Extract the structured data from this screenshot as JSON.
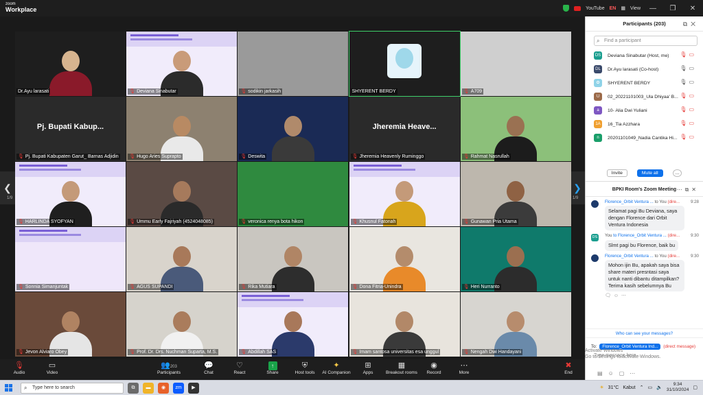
{
  "titlebar": {
    "brand_small": "zoom",
    "brand_big": "Workplace",
    "youtube": "YouTube",
    "lang": "EN",
    "view": "View"
  },
  "colors": {
    "accent": "#0e71eb",
    "muted": "#e53935",
    "toolbar_bg": "#1e1e1e",
    "stage_bg": "#1a1a1a"
  },
  "nav": {
    "page_left": "1/9",
    "page_right": "1/9"
  },
  "tiles": [
    {
      "name": "Dr.Ayu larasati",
      "muted": false
    },
    {
      "name": "Deviana Sinabutar",
      "muted": true
    },
    {
      "name": "sodikin jarkasih",
      "muted": true
    },
    {
      "name": "SHYERENT BERDY",
      "muted": false
    },
    {
      "name": "A709",
      "muted": true
    },
    {
      "name": "Pj. Bupati Kabupaten Garut_ Barnas Adjidin",
      "muted": true,
      "big": "Pj. Bupati Kabup..."
    },
    {
      "name": "Hugo Aries Suprapto",
      "muted": true
    },
    {
      "name": "Deswita",
      "muted": true
    },
    {
      "name": "Jheremia Heavenly Ruminggo",
      "muted": true,
      "big": "Jheremia Heave..."
    },
    {
      "name": "Rahmat Nasrullah",
      "muted": true
    },
    {
      "name": "HARLINDA SYOFYAN",
      "muted": true
    },
    {
      "name": "Ummu Early Fajriyah (4524048085)",
      "muted": true
    },
    {
      "name": "veronica renya bota hikon",
      "muted": true
    },
    {
      "name": "Khusnul Fatonah",
      "muted": true
    },
    {
      "name": "Gunawan Pria Utama",
      "muted": true
    },
    {
      "name": "Sonnia Simanjuntak",
      "muted": true
    },
    {
      "name": "AGUS SUPANDI",
      "muted": true
    },
    {
      "name": "Rika Mutiara",
      "muted": true
    },
    {
      "name": "Dona Fitria-Unindra",
      "muted": true
    },
    {
      "name": "Heri Nurranto",
      "muted": true
    },
    {
      "name": "Jevon Alviaro Obey",
      "muted": true
    },
    {
      "name": "Prof. Dr. Drs. Nuchman Suparta, M.S.",
      "muted": true
    },
    {
      "name": "Abdillah SAS",
      "muted": true
    },
    {
      "name": "Imam santosa universitas esa unggul",
      "muted": true
    },
    {
      "name": "Nengah Dwi Handayani",
      "muted": true
    }
  ],
  "toolbar": {
    "audio": "Audio",
    "video": "Video",
    "participants": "Participants",
    "participants_count": "203",
    "chat": "Chat",
    "react": "React",
    "share": "Share",
    "host_tools": "Host tools",
    "ai_companion": "AI Companion",
    "apps": "Apps",
    "breakout": "Breakout rooms",
    "record": "Record",
    "more": "More",
    "end": "End"
  },
  "participants_panel": {
    "title": "Participants (203)",
    "search_placeholder": "Find a participant",
    "rows": [
      {
        "initials": "DS",
        "color": "#1a9e8f",
        "name": "Deviana Sinabutar (Host, me)"
      },
      {
        "initials": "DL",
        "color": "#3a4a6b",
        "name": "Dr.Ayu larasati (Co-host)"
      },
      {
        "initials": "✿",
        "color": "#8fd3e8",
        "name": "SHYERENT BERDY"
      },
      {
        "initials": "U",
        "color": "#9c6b4a",
        "name": "02_20221101003_Ula Dhiyaa' B..."
      },
      {
        "initials": "a",
        "color": "#7e57c2",
        "name": "10- Alia Dwi Yuliani"
      },
      {
        "initials": "1A",
        "color": "#f0a030",
        "name": "16_Tia Azzhara"
      },
      {
        "initials": "n",
        "color": "#1a9e6a",
        "name": "20201101049_Nadia Cantika Hi..."
      }
    ],
    "invite": "Invite",
    "mute_all": "Mute all",
    "more": "..."
  },
  "chat_panel": {
    "title": "BPKI Room's Zoom Meeting",
    "messages": [
      {
        "from": "Florence_Orbit Ventura ...",
        "to": "to You",
        "dm": "(dire...",
        "time": "9:28",
        "text": "Selamat pagi Bu Deviana, saya dengan Florence dari Orbit Ventura Indonesia",
        "avatar": ""
      },
      {
        "from": "You",
        "to": "to Florence_Orbit Ventura ...",
        "dm": "(dire...",
        "time": "9:30",
        "text": "Slmt pagi bu Florence, baik bu",
        "avatar": "DS"
      },
      {
        "from": "Florence_Orbit Ventura ...",
        "to": "to You",
        "dm": "(dire...",
        "time": "9:30",
        "text": "Mohon ijin Bu, apakah saya bisa share materi presntasi saya untuk nanti dibantu ditampilkan? Terima kasih sebelumnya Bu",
        "avatar": ""
      }
    ],
    "who_can_see": "Who can see your messages?",
    "to_label": "To:",
    "to_value": "Florence_Orbit Ventura Ind...",
    "direct": "(direct message)",
    "type_placeholder": "Type message here..."
  },
  "watermark": {
    "line1": "Activate Windows",
    "line2": "Go to Settings to activate Windows."
  },
  "taskbar": {
    "search": "Type here to search",
    "weather": "31°C",
    "weather_desc": "Kabut",
    "time": "9:34",
    "date": "31/10/2024"
  }
}
